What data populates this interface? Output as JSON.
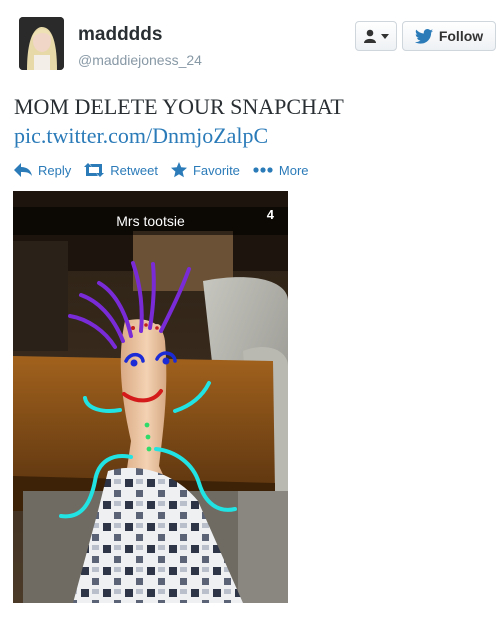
{
  "user": {
    "display_name": "madddds",
    "handle": "@maddiejoness_24"
  },
  "header": {
    "user_dropdown_icon": "person-icon",
    "follow_label": "Follow",
    "follow_icon": "twitter-bird-icon"
  },
  "tweet": {
    "text": "MOM DELETE YOUR SNAPCHAT",
    "link": "pic.twitter.com/DnmjoZalpC"
  },
  "actions": [
    {
      "label": "Reply",
      "icon": "reply-icon"
    },
    {
      "label": "Retweet",
      "icon": "retweet-icon"
    },
    {
      "label": "Favorite",
      "icon": "star-icon"
    },
    {
      "label": "More",
      "icon": "more-dots-icon"
    }
  ],
  "media": {
    "caption": "Mrs tootsie",
    "timer": "4"
  },
  "colors": {
    "link": "#2b7bb9",
    "muted": "#8899a6",
    "purple_doodle": "#7a2bd8",
    "blue_doodle": "#1b2bd6",
    "red_doodle": "#d41a1a",
    "cyan_doodle": "#22e3e3",
    "green_doodle": "#2fdc6a"
  }
}
